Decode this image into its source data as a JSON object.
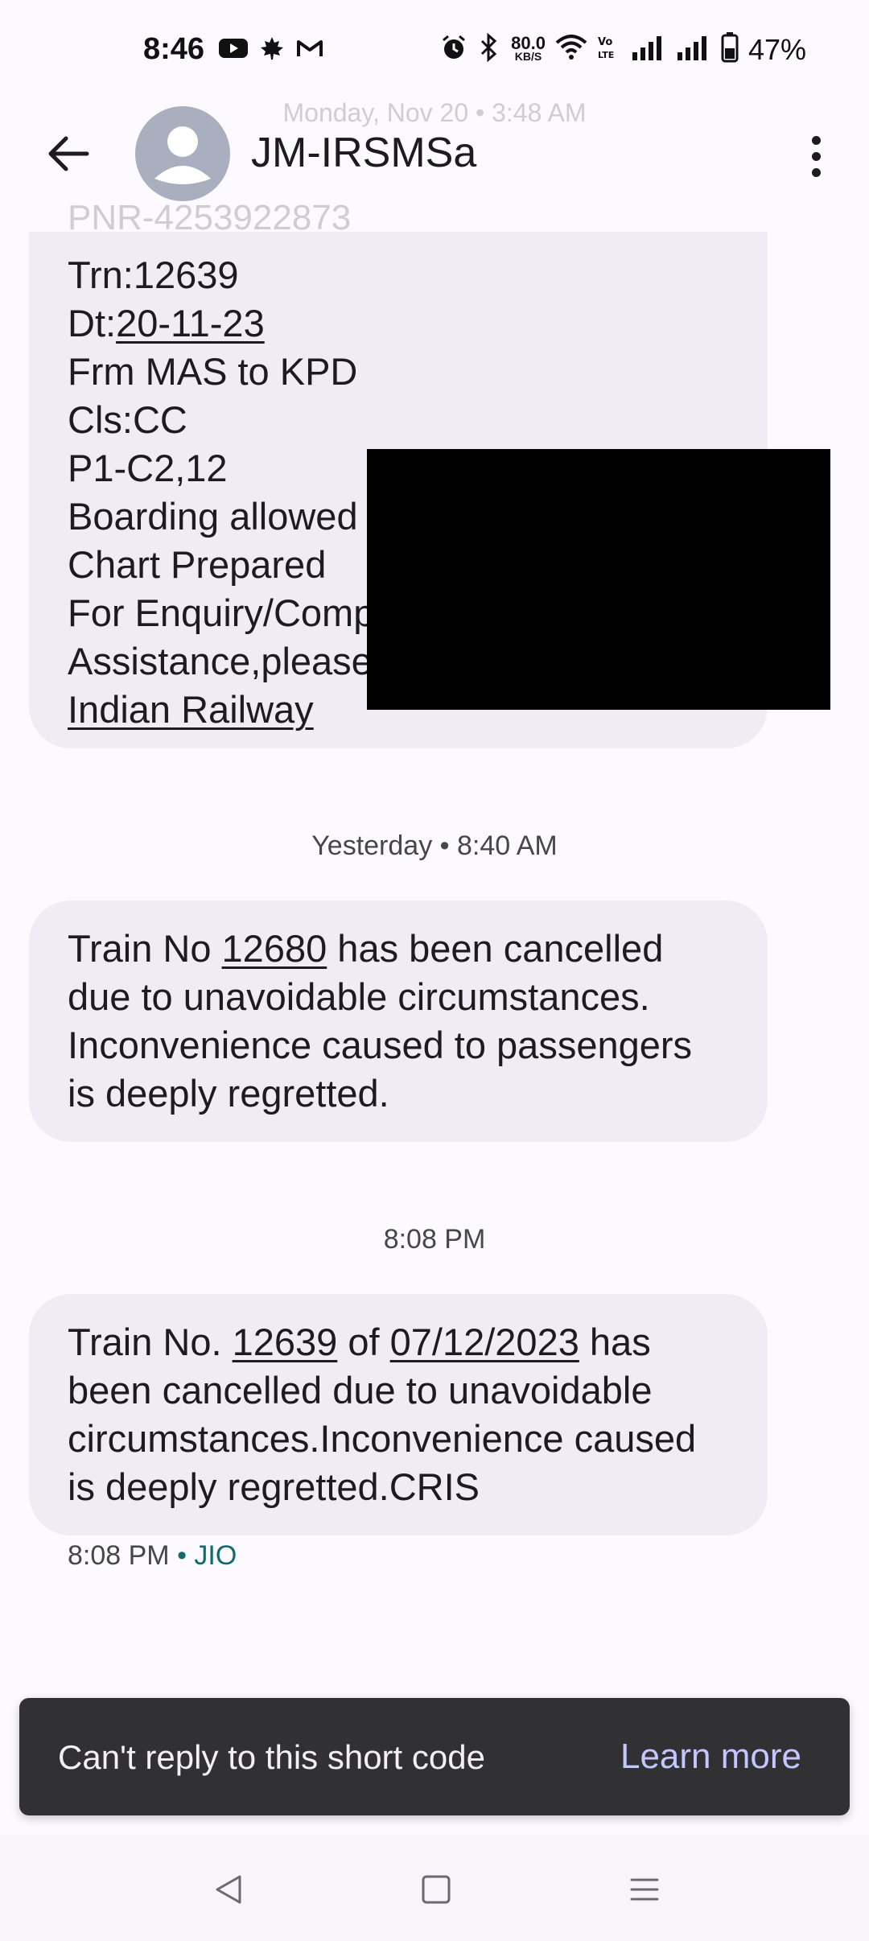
{
  "status_bar": {
    "time": "8:46",
    "network_speed_value": "80.0",
    "network_speed_unit": "KB/S",
    "battery_percent": "47%"
  },
  "background_faded": {
    "date": "Monday, Nov 20 • 3:48 AM",
    "pnr": "PNR-4253922873"
  },
  "header": {
    "contact_name": "JM-IRSMSa"
  },
  "messages": [
    {
      "lines": [
        "Trn:12639",
        "Dt:",
        "20-11-23",
        "Frm MAS to KPD",
        "Cls:CC",
        "P1-C2,12",
        "Boarding allowed",
        "Chart Prepared",
        "For Enquiry/Comp",
        "Assistance,please",
        "Indian Railway"
      ]
    },
    {
      "timestamp": "Yesterday • 8:40 AM",
      "text_before": "Train No ",
      "link_1": "12680",
      "text_after": " has been cancelled due to unavoidable circumstances. Inconvenience caused to passengers is deeply regretted."
    },
    {
      "timestamp": "8:08 PM",
      "text_before": "Train No. ",
      "link_1": "12639",
      "text_mid": " of ",
      "link_2": "07/12/2023",
      "text_after": " has been cancelled due to unavoidable circumstances.Inconvenience caused is deeply regretted.CRIS",
      "meta_time": "8:08 PM",
      "meta_sep": " • ",
      "meta_carrier": "JIO"
    }
  ],
  "snackbar": {
    "text": "Can't reply to this short code",
    "action": "Learn more"
  },
  "colors": {
    "bubble": "#efedf3",
    "snackbar": "#313033",
    "snackbar_action": "#c3c6ff",
    "carrier": "#0f6b6e"
  }
}
